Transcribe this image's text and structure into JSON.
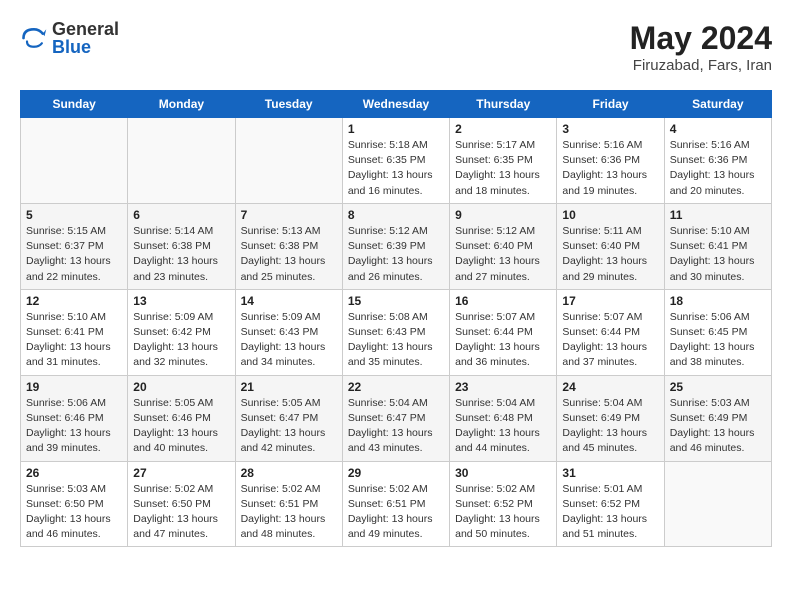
{
  "logo": {
    "general": "General",
    "blue": "Blue"
  },
  "title": {
    "month_year": "May 2024",
    "location": "Firuzabad, Fars, Iran"
  },
  "days_of_week": [
    "Sunday",
    "Monday",
    "Tuesday",
    "Wednesday",
    "Thursday",
    "Friday",
    "Saturday"
  ],
  "weeks": [
    [
      {
        "day": "",
        "info": ""
      },
      {
        "day": "",
        "info": ""
      },
      {
        "day": "",
        "info": ""
      },
      {
        "day": "1",
        "info": "Sunrise: 5:18 AM\nSunset: 6:35 PM\nDaylight: 13 hours and 16 minutes."
      },
      {
        "day": "2",
        "info": "Sunrise: 5:17 AM\nSunset: 6:35 PM\nDaylight: 13 hours and 18 minutes."
      },
      {
        "day": "3",
        "info": "Sunrise: 5:16 AM\nSunset: 6:36 PM\nDaylight: 13 hours and 19 minutes."
      },
      {
        "day": "4",
        "info": "Sunrise: 5:16 AM\nSunset: 6:36 PM\nDaylight: 13 hours and 20 minutes."
      }
    ],
    [
      {
        "day": "5",
        "info": "Sunrise: 5:15 AM\nSunset: 6:37 PM\nDaylight: 13 hours and 22 minutes."
      },
      {
        "day": "6",
        "info": "Sunrise: 5:14 AM\nSunset: 6:38 PM\nDaylight: 13 hours and 23 minutes."
      },
      {
        "day": "7",
        "info": "Sunrise: 5:13 AM\nSunset: 6:38 PM\nDaylight: 13 hours and 25 minutes."
      },
      {
        "day": "8",
        "info": "Sunrise: 5:12 AM\nSunset: 6:39 PM\nDaylight: 13 hours and 26 minutes."
      },
      {
        "day": "9",
        "info": "Sunrise: 5:12 AM\nSunset: 6:40 PM\nDaylight: 13 hours and 27 minutes."
      },
      {
        "day": "10",
        "info": "Sunrise: 5:11 AM\nSunset: 6:40 PM\nDaylight: 13 hours and 29 minutes."
      },
      {
        "day": "11",
        "info": "Sunrise: 5:10 AM\nSunset: 6:41 PM\nDaylight: 13 hours and 30 minutes."
      }
    ],
    [
      {
        "day": "12",
        "info": "Sunrise: 5:10 AM\nSunset: 6:41 PM\nDaylight: 13 hours and 31 minutes."
      },
      {
        "day": "13",
        "info": "Sunrise: 5:09 AM\nSunset: 6:42 PM\nDaylight: 13 hours and 32 minutes."
      },
      {
        "day": "14",
        "info": "Sunrise: 5:09 AM\nSunset: 6:43 PM\nDaylight: 13 hours and 34 minutes."
      },
      {
        "day": "15",
        "info": "Sunrise: 5:08 AM\nSunset: 6:43 PM\nDaylight: 13 hours and 35 minutes."
      },
      {
        "day": "16",
        "info": "Sunrise: 5:07 AM\nSunset: 6:44 PM\nDaylight: 13 hours and 36 minutes."
      },
      {
        "day": "17",
        "info": "Sunrise: 5:07 AM\nSunset: 6:44 PM\nDaylight: 13 hours and 37 minutes."
      },
      {
        "day": "18",
        "info": "Sunrise: 5:06 AM\nSunset: 6:45 PM\nDaylight: 13 hours and 38 minutes."
      }
    ],
    [
      {
        "day": "19",
        "info": "Sunrise: 5:06 AM\nSunset: 6:46 PM\nDaylight: 13 hours and 39 minutes."
      },
      {
        "day": "20",
        "info": "Sunrise: 5:05 AM\nSunset: 6:46 PM\nDaylight: 13 hours and 40 minutes."
      },
      {
        "day": "21",
        "info": "Sunrise: 5:05 AM\nSunset: 6:47 PM\nDaylight: 13 hours and 42 minutes."
      },
      {
        "day": "22",
        "info": "Sunrise: 5:04 AM\nSunset: 6:47 PM\nDaylight: 13 hours and 43 minutes."
      },
      {
        "day": "23",
        "info": "Sunrise: 5:04 AM\nSunset: 6:48 PM\nDaylight: 13 hours and 44 minutes."
      },
      {
        "day": "24",
        "info": "Sunrise: 5:04 AM\nSunset: 6:49 PM\nDaylight: 13 hours and 45 minutes."
      },
      {
        "day": "25",
        "info": "Sunrise: 5:03 AM\nSunset: 6:49 PM\nDaylight: 13 hours and 46 minutes."
      }
    ],
    [
      {
        "day": "26",
        "info": "Sunrise: 5:03 AM\nSunset: 6:50 PM\nDaylight: 13 hours and 46 minutes."
      },
      {
        "day": "27",
        "info": "Sunrise: 5:02 AM\nSunset: 6:50 PM\nDaylight: 13 hours and 47 minutes."
      },
      {
        "day": "28",
        "info": "Sunrise: 5:02 AM\nSunset: 6:51 PM\nDaylight: 13 hours and 48 minutes."
      },
      {
        "day": "29",
        "info": "Sunrise: 5:02 AM\nSunset: 6:51 PM\nDaylight: 13 hours and 49 minutes."
      },
      {
        "day": "30",
        "info": "Sunrise: 5:02 AM\nSunset: 6:52 PM\nDaylight: 13 hours and 50 minutes."
      },
      {
        "day": "31",
        "info": "Sunrise: 5:01 AM\nSunset: 6:52 PM\nDaylight: 13 hours and 51 minutes."
      },
      {
        "day": "",
        "info": ""
      }
    ]
  ]
}
